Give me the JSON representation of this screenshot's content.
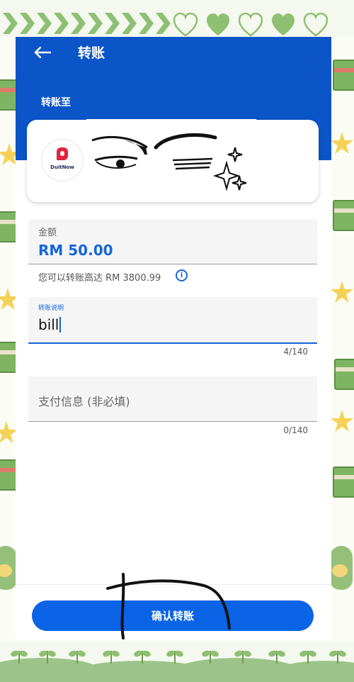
{
  "header": {
    "title": "转账",
    "back_icon": "arrow-left-icon"
  },
  "recipient": {
    "section_label": "转账至",
    "bank_logo_text": "DuitNow"
  },
  "amount": {
    "label": "金额",
    "value": "RM 50.00",
    "limit_text": "您可以转账高达 RM 3800.99",
    "info_icon": "info-circle-icon"
  },
  "reference": {
    "label": "转账说明",
    "value": "bill",
    "counter": "4/140"
  },
  "payment_info": {
    "placeholder": "支付信息 (非必填)",
    "counter": "0/140"
  },
  "actions": {
    "confirm_label": "确认转账"
  },
  "colors": {
    "header_blue": "#0b55c8",
    "accent": "#1565d8",
    "button": "#0b63e6",
    "frame_green": "#8fbf73"
  }
}
